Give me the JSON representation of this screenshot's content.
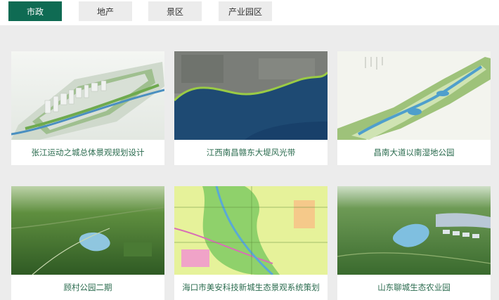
{
  "tabs": [
    {
      "label": "市政",
      "active": true
    },
    {
      "label": "地产",
      "active": false
    },
    {
      "label": "景区",
      "active": false
    },
    {
      "label": "产业园区",
      "active": false
    }
  ],
  "projects": [
    {
      "title": "张江运动之城总体景观规划设计",
      "thumb": "aerial-city-plan"
    },
    {
      "title": "江西南昌赣东大堤风光带",
      "thumb": "riverbank-aerial"
    },
    {
      "title": "昌南大道以南湿地公园",
      "thumb": "wetland-park-plan"
    },
    {
      "title": "顾村公园二期",
      "thumb": "park-aerial"
    },
    {
      "title": "海口市美安科技新城生态景观系统策划",
      "thumb": "master-plan-map"
    },
    {
      "title": "山东聊城生态农业园",
      "thumb": "agri-park-aerial"
    }
  ],
  "colors": {
    "accent": "#0f6b53",
    "caption": "#2a6b4e",
    "background": "#ececec"
  }
}
